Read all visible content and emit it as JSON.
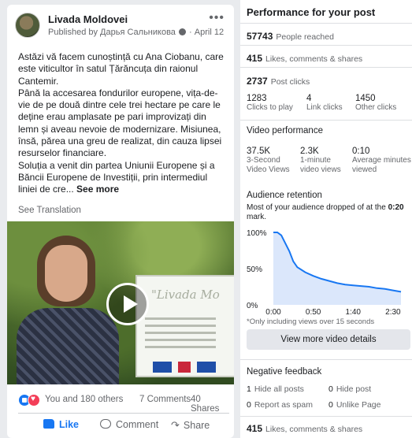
{
  "post": {
    "page_name": "Livada Moldovei",
    "published_by": "Published by Дарья Сальникова",
    "date": "April 12",
    "paragraphs": [
      "Astăzi vă facem cunoștință cu Ana Ciobanu, care este viticultor în satul Țărăncuța din raionul Cantemir.",
      "Până la accesarea fondurilor europene, vița-de-vie de pe două dintre cele trei hectare pe care le deține erau amplasate pe pari improvizați din lemn și aveau nevoie de modernizare. Misiunea, însă, părea una greu de realizat, din cauza lipsei resurselor financiare.",
      "Soluția a venit din partea Uniunii Europene și a Băncii Europene de Investiții, prin intermediul liniei de cre..."
    ],
    "see_more": "See more",
    "see_translation": "See Translation",
    "video_sign_title": "\"Livada Mo",
    "reactions_text": "You and 180 others",
    "comments_text": "7 Comments",
    "shares_text": "40 Shares",
    "actions": {
      "like": "Like",
      "comment": "Comment",
      "share": "Share"
    }
  },
  "insights": {
    "title": "Performance for your post",
    "people_reached": {
      "value": "57743",
      "label": "People reached"
    },
    "engagement": {
      "value": "415",
      "label": "Likes, comments & shares"
    },
    "post_clicks": {
      "value": "2737",
      "label": "Post clicks"
    },
    "click_breakdown": [
      {
        "value": "1283",
        "label": "Clicks to play"
      },
      {
        "value": "4",
        "label": "Link clicks"
      },
      {
        "value": "1450",
        "label": "Other clicks"
      }
    ],
    "video_performance_title": "Video performance",
    "video_stats": [
      {
        "value": "37.5K",
        "label1": "3-Second",
        "label2": "Video Views"
      },
      {
        "value": "2.3K",
        "label1": "1-minute",
        "label2": "video views"
      },
      {
        "value": "0:10",
        "label1": "Average minutes",
        "label2": "viewed"
      }
    ],
    "retention_title": "Audience retention",
    "retention_desc_prefix": "Most of your audience dropped of at the",
    "retention_desc_bold": "0:20",
    "retention_desc_suffix": "mark.",
    "retention_note": "*Only including views over 15 seconds",
    "view_details_button": "View more video details",
    "negative_title": "Negative feedback",
    "negative_items": [
      {
        "value": "1",
        "label": "Hide all posts"
      },
      {
        "value": "0",
        "label": "Hide post"
      },
      {
        "value": "0",
        "label": "Report as spam"
      },
      {
        "value": "0",
        "label": "Unlike Page"
      }
    ],
    "footer_engagement": {
      "value": "415",
      "label": "Likes, comments & shares"
    },
    "colors": {
      "retention_line": "#1877f2",
      "retention_fill": "#dbe7fb"
    }
  },
  "chart_data": {
    "type": "area",
    "title": "Audience retention",
    "xlabel": "",
    "ylabel": "",
    "x_ticks": [
      "0:00",
      "0:50",
      "1:40",
      "2:30"
    ],
    "y_ticks": [
      "0%",
      "50%",
      "100%"
    ],
    "xlim": [
      0,
      160
    ],
    "ylim": [
      0,
      100
    ],
    "grid": false,
    "series": [
      {
        "x": [
          0,
          5,
          10,
          15,
          20,
          25,
          30,
          40,
          50,
          60,
          70,
          80,
          90,
          100,
          110,
          120,
          130,
          140,
          150,
          160
        ],
        "values": [
          100,
          100,
          96,
          85,
          74,
          60,
          52,
          45,
          40,
          36,
          33,
          30,
          28,
          27,
          26,
          25,
          23,
          22,
          20,
          18
        ]
      }
    ]
  }
}
